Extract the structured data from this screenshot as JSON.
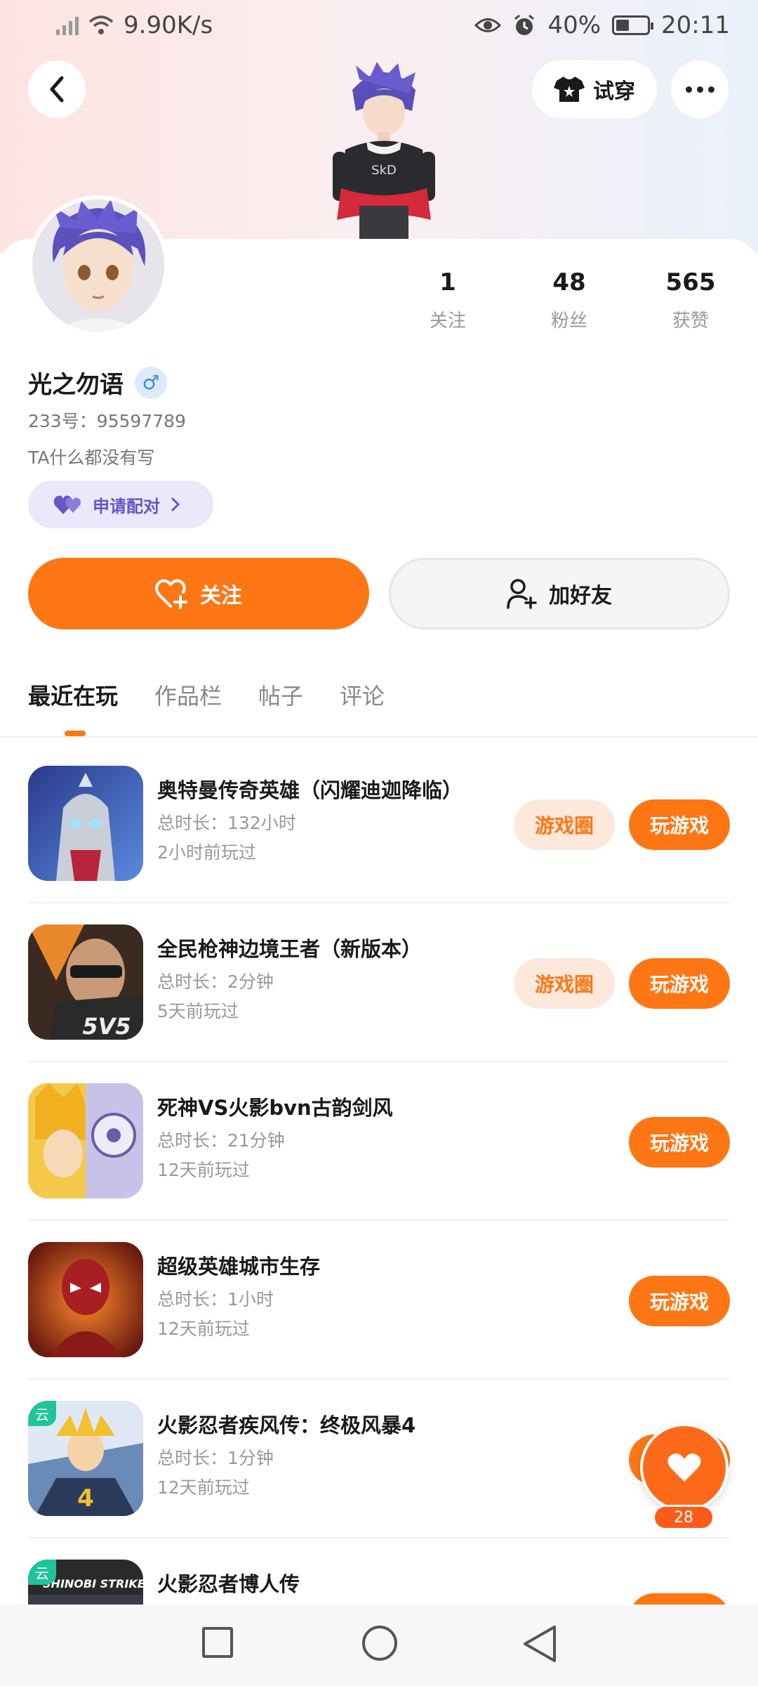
{
  "status_bar": {
    "net_speed": "9.90K/s",
    "battery": "40%",
    "time": "20:11"
  },
  "header": {
    "tryon_label": "试穿"
  },
  "profile": {
    "username": "光之勿语",
    "gender_symbol": "♂",
    "uid": "233号：95597789",
    "bio": "TA什么都没有写",
    "pair_label": "申请配对",
    "stats": [
      {
        "num": "1",
        "label": "关注"
      },
      {
        "num": "48",
        "label": "粉丝"
      },
      {
        "num": "565",
        "label": "获赞"
      }
    ]
  },
  "actions": {
    "follow_label": "关注",
    "add_friend_label": "加好友"
  },
  "tabs": [
    "最近在玩",
    "作品栏",
    "帖子",
    "评论"
  ],
  "games": [
    {
      "title": "奥特曼传奇英雄（闪耀迪迦降临）",
      "duration": "总时长：132小时",
      "last_played": "2小时前玩过",
      "circle_label": "游戏圈",
      "play_label": "玩游戏"
    },
    {
      "title": "全民枪神边境王者（新版本）",
      "duration": "总时长：2分钟",
      "last_played": "5天前玩过",
      "circle_label": "游戏圈",
      "play_label": "玩游戏",
      "icon_text": "5V5"
    },
    {
      "title": "死神VS火影bvn古韵剑风",
      "duration": "总时长：21分钟",
      "last_played": "12天前玩过",
      "play_label": "玩游戏"
    },
    {
      "title": "超级英雄城市生存",
      "duration": "总时长：1小时",
      "last_played": "12天前玩过",
      "play_label": "玩游戏"
    },
    {
      "title": "火影忍者疾风传：终极风暴4",
      "duration": "总时长：1分钟",
      "last_played": "12天前玩过",
      "cloud_tag": "云"
    },
    {
      "title": "火影忍者博人传",
      "cloud_tag": "云",
      "icon_text": "SHINOBI STRIKER"
    }
  ],
  "fab": {
    "count": "28"
  },
  "colors": {
    "accent": "#ff7614",
    "pair": "#6656c7"
  }
}
